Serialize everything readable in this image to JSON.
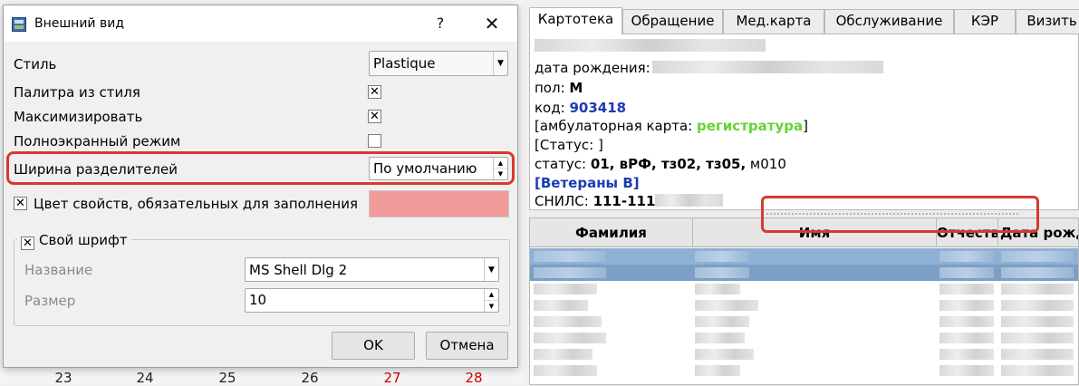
{
  "dialog": {
    "title": "Внешний вид",
    "help_glyph": "?",
    "close_glyph": "✕",
    "style_label": "Стиль",
    "style_value": "Plastique",
    "palette_label": "Палитра из стиля",
    "palette_checked": "✕",
    "maximize_label": "Максимизировать",
    "maximize_checked": "✕",
    "fullscreen_label": "Полноэкранный режим",
    "splitter_label": "Ширина разделителей",
    "splitter_value": "По умолчанию",
    "required_color_label": "Цвет свойств, обязательных для заполнения",
    "required_color_checked": "✕",
    "required_color": "#f19a9a",
    "font_group": {
      "label": "Свой шрифт",
      "checked": "✕",
      "name_label": "Название",
      "name_value": "MS Shell Dlg 2",
      "size_label": "Размер",
      "size_value": "10"
    },
    "ok_label": "OK",
    "cancel_label": "Отмена"
  },
  "calendar": {
    "days": [
      "23",
      "24",
      "25",
      "26",
      "27",
      "28"
    ]
  },
  "tabs": [
    "Картотека",
    "Обращение",
    "Мед.карта",
    "Обслуживание",
    "КЭР",
    "Визить"
  ],
  "card": {
    "birth_label": "дата рождения:",
    "sex_label": "пол:",
    "sex_value": "М",
    "code_label": "код:",
    "code_value": "903418",
    "amb_prefix": "[амбулаторная карта:",
    "amb_value": "регистратура",
    "amb_suffix": "]",
    "status_line": "[Статус: ]",
    "status_label": "статус:",
    "status_values": "01, вРФ, тз02, тз05,",
    "status_extra": "м010",
    "veterans": "[Ветераны В]",
    "snils_label": "СНИЛС:",
    "snils_value": "111-111"
  },
  "grid": {
    "columns": [
      "Фамилия",
      "Имя",
      "Отчество",
      "Дата рожд"
    ]
  }
}
